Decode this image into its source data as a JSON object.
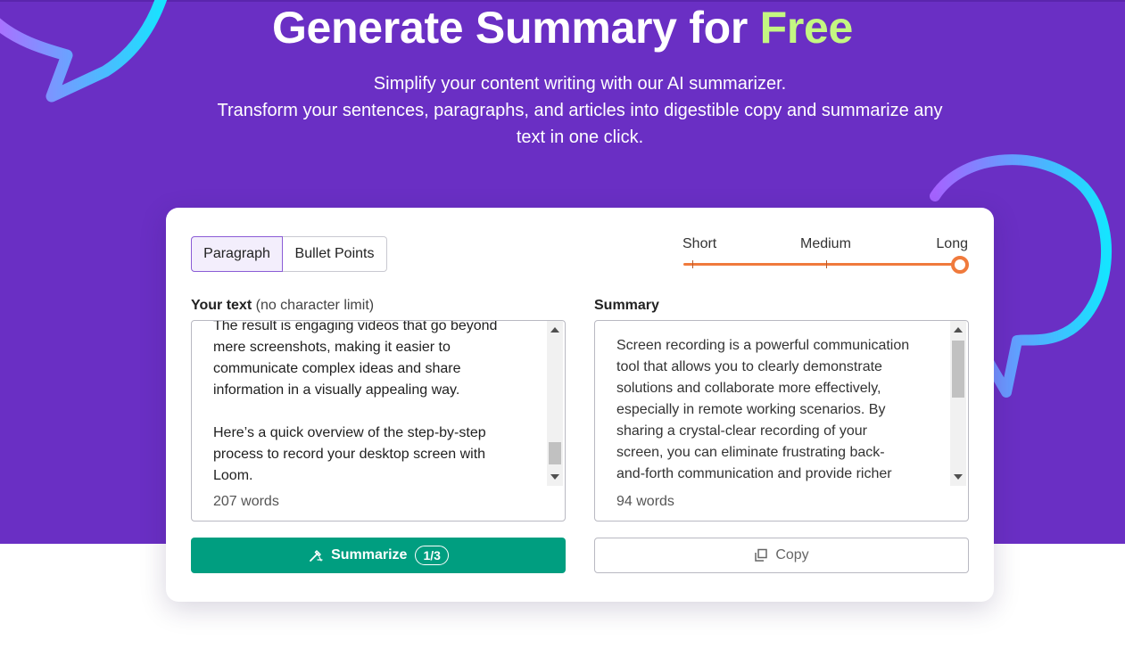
{
  "hero": {
    "headline_main": "Generate Summary for ",
    "headline_accent": "Free",
    "subtitle_line1": "Simplify your content writing with our AI summarizer.",
    "subtitle_line2": "Transform your sentences, paragraphs, and articles into digestible copy and summarize any",
    "subtitle_line3": "text in one click.",
    "colors": {
      "background": "#6a2fc4",
      "accent": "#c4f782"
    }
  },
  "mode": {
    "options": [
      "Paragraph",
      "Bullet Points"
    ],
    "selected": "Paragraph"
  },
  "length": {
    "options": [
      "Short",
      "Medium",
      "Long"
    ],
    "selected": "Long",
    "accent_color": "#f07a3c"
  },
  "input": {
    "label": "Your text",
    "label_note": "(no character limit)",
    "text": "The result is engaging videos that go beyond\nmere screenshots, making it easier to\ncommunicate complex ideas and share\ninformation in a visually appealing way.\n\nHere’s a quick overview of the step-by-step\nprocess to record your desktop screen with\nLoom.",
    "word_count": "207 words"
  },
  "output": {
    "label": "Summary",
    "text": "Screen recording is a powerful communication\ntool that allows you to clearly demonstrate\nsolutions and collaborate more effectively,\nespecially in remote working scenarios. By\nsharing a crystal-clear recording of your\nscreen, you can eliminate frustrating back-\nand-forth communication and provide richer",
    "word_count": "94 words"
  },
  "actions": {
    "summarize_label": "Summarize",
    "summarize_counter": "1/3",
    "summarize_color": "#009e80",
    "copy_label": "Copy"
  },
  "icons": {
    "summarize": "magic-wand-icon",
    "copy": "copy-icon",
    "scroll_up": "scroll-up-arrow-icon",
    "scroll_down": "scroll-down-arrow-icon"
  }
}
